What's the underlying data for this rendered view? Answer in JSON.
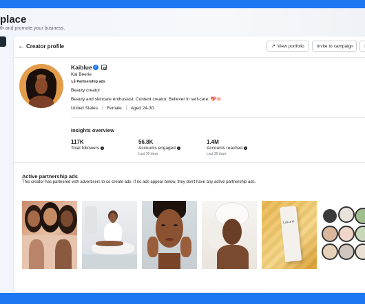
{
  "page": {
    "title": "place",
    "subtitle": "th and promote your business."
  },
  "header": {
    "title": "Creator profile",
    "view_portfolio": "View portfolio",
    "invite": "Invite to campaign",
    "more": "S"
  },
  "profile": {
    "username": "Kaiblue",
    "full_name": "Kai Beerie",
    "partnership_badge": "Partnership ads",
    "category": "Beauty creator",
    "bio": "Beauty and skincare enthusiast.  Content creator. Believer in self-care. 💖🪷",
    "country": "United States",
    "gender": "Female",
    "age": "Aged 24-30"
  },
  "insights": {
    "title": "Insights overview",
    "metrics": [
      {
        "value": "117K",
        "label": "Total followers",
        "sub": ""
      },
      {
        "value": "56.8K",
        "label": "Accounts engaged",
        "sub": "Last 30 days"
      },
      {
        "value": "1.4M",
        "label": "Accounts reached",
        "sub": "Last 30 days"
      }
    ]
  },
  "ads": {
    "title": "Active partnership ads",
    "description": "This creator has partnered with advertisers to co-create ads. If no ads appear below, they don't have any active partnership ads.",
    "product_label": "LaLune"
  },
  "icons": {
    "back": "arrow-left-icon",
    "external": "external-link-icon",
    "verified": "verified-badge-icon",
    "instagram": "instagram-icon",
    "megaphone": "megaphone-icon",
    "info": "info-icon"
  },
  "colors": {
    "accent": "#1e77f2",
    "text": "#1c1e21",
    "muted": "#606770"
  }
}
